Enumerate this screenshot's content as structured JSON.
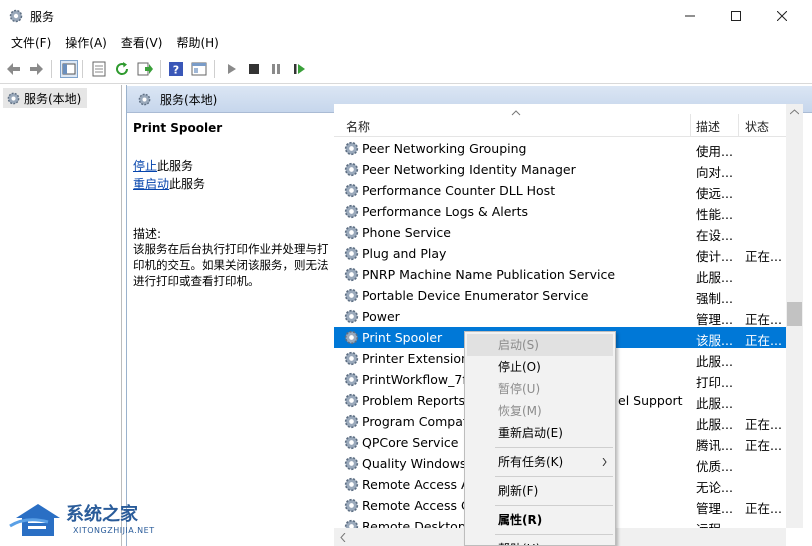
{
  "window": {
    "title": "服务"
  },
  "menu": [
    "文件(F)",
    "操作(A)",
    "查看(V)",
    "帮助(H)"
  ],
  "tree": {
    "item": "服务(本地)"
  },
  "panel": {
    "header": "服务(本地)"
  },
  "description": {
    "service_name": "Print Spooler",
    "stop_link": "停止",
    "stop_suffix": "此服务",
    "restart_link": "重启动",
    "restart_suffix": "此服务",
    "label": "描述:",
    "text": "该服务在后台执行打印作业并处理与打印机的交互。如果关闭该服务，则无法进行打印或查看打印机。"
  },
  "columns": {
    "name": "名称",
    "desc": "描述",
    "state": "状态"
  },
  "services": [
    {
      "name": "Peer Networking Grouping",
      "desc": "使用...",
      "state": ""
    },
    {
      "name": "Peer Networking Identity Manager",
      "desc": "向对...",
      "state": ""
    },
    {
      "name": "Performance Counter DLL Host",
      "desc": "使远...",
      "state": ""
    },
    {
      "name": "Performance Logs & Alerts",
      "desc": "性能...",
      "state": ""
    },
    {
      "name": "Phone Service",
      "desc": "在设...",
      "state": ""
    },
    {
      "name": "Plug and Play",
      "desc": "使计...",
      "state": "正在..."
    },
    {
      "name": "PNRP Machine Name Publication Service",
      "desc": "此服...",
      "state": ""
    },
    {
      "name": "Portable Device Enumerator Service",
      "desc": "强制...",
      "state": ""
    },
    {
      "name": "Power",
      "desc": "管理...",
      "state": "正在..."
    },
    {
      "name": "Print Spooler",
      "desc": "该服...",
      "state": "正在...",
      "selected": true
    },
    {
      "name": "Printer Extensions",
      "desc": "此服...",
      "state": ""
    },
    {
      "name": "PrintWorkflow_7fa",
      "desc": "打印...",
      "state": ""
    },
    {
      "name": "Problem Reports",
      "desc": "此服...",
      "state": "",
      "tail": "el Support"
    },
    {
      "name": "Program Compat",
      "desc": "此服...",
      "state": "正在..."
    },
    {
      "name": "QPCore Service",
      "desc": "腾讯...",
      "state": "正在..."
    },
    {
      "name": "Quality Windows",
      "desc": "优质...",
      "state": ""
    },
    {
      "name": "Remote Access A",
      "desc": "无论...",
      "state": ""
    },
    {
      "name": "Remote Access C",
      "desc": "管理...",
      "state": "正在..."
    },
    {
      "name": "Remote Desktop",
      "desc": "远程...",
      "state": ""
    }
  ],
  "context_menu": [
    {
      "label": "启动(S)",
      "disabled": true
    },
    {
      "label": "停止(O)",
      "disabled": false
    },
    {
      "label": "暂停(U)",
      "disabled": true
    },
    {
      "label": "恢复(M)",
      "disabled": true
    },
    {
      "label": "重新启动(E)",
      "disabled": false
    },
    {
      "label": "所有任务(K)",
      "disabled": false,
      "submenu": true
    },
    {
      "label": "刷新(F)",
      "disabled": false
    },
    {
      "label": "属性(R)",
      "disabled": false,
      "bold": true
    },
    {
      "label": "帮助(H)",
      "disabled": false
    }
  ],
  "watermark": {
    "main": "系统之家",
    "sub": "XITONGZHIJIA.NET"
  },
  "colors": {
    "selection": "#0078d7",
    "link": "#0645ad",
    "header_bg": "#c6d6ec"
  }
}
